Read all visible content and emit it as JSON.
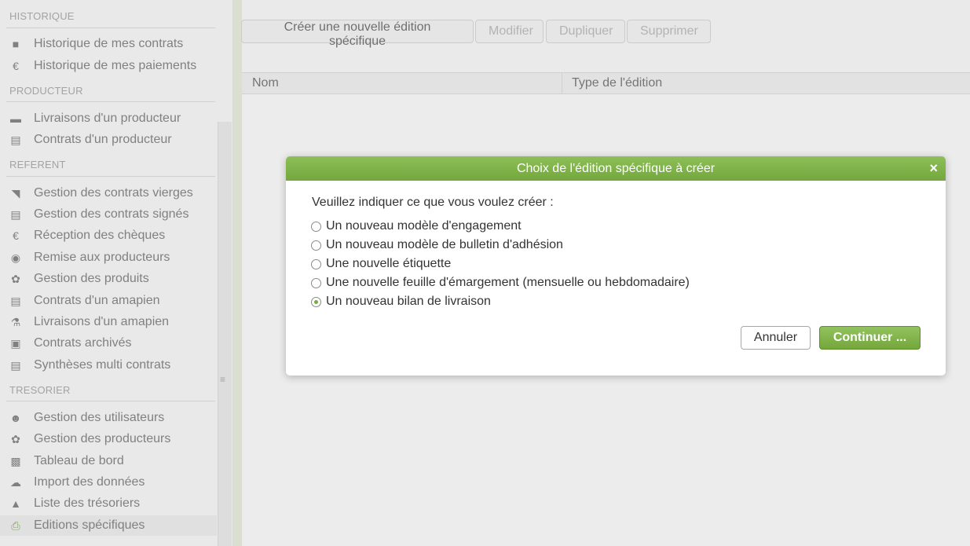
{
  "sidebar": {
    "sections": [
      {
        "title": "HISTORIQUE",
        "items": [
          {
            "label": "Historique de mes contrats",
            "icon": "book-icon"
          },
          {
            "label": "Historique de mes paiements",
            "icon": "euro-icon"
          }
        ]
      },
      {
        "title": "PRODUCTEUR",
        "items": [
          {
            "label": "Livraisons d'un producteur",
            "icon": "truck-icon"
          },
          {
            "label": "Contrats d'un producteur",
            "icon": "document-icon"
          }
        ]
      },
      {
        "title": "REFERENT",
        "items": [
          {
            "label": "Gestion des contrats vierges",
            "icon": "folder-open-icon"
          },
          {
            "label": "Gestion des contrats signés",
            "icon": "document-icon"
          },
          {
            "label": "Réception des chèques",
            "icon": "euro-icon"
          },
          {
            "label": "Remise aux producteurs",
            "icon": "money-icon"
          },
          {
            "label": "Gestion des produits",
            "icon": "leaf-icon"
          },
          {
            "label": "Contrats d'un amapien",
            "icon": "document-icon"
          },
          {
            "label": "Livraisons d'un amapien",
            "icon": "cutlery-icon"
          },
          {
            "label": "Contrats archivés",
            "icon": "archive-icon"
          },
          {
            "label": "Synthèses multi contrats",
            "icon": "document-icon"
          }
        ]
      },
      {
        "title": "TRESORIER",
        "items": [
          {
            "label": "Gestion des utilisateurs",
            "icon": "users-icon"
          },
          {
            "label": "Gestion des producteurs",
            "icon": "leaf-icon"
          },
          {
            "label": "Tableau de bord",
            "icon": "chart-icon"
          },
          {
            "label": "Import des données",
            "icon": "cloud-upload-icon"
          },
          {
            "label": "Liste des trésoriers",
            "icon": "graduation-cap-icon"
          },
          {
            "label": "Editions spécifiques",
            "icon": "printer-icon",
            "active": true
          }
        ]
      }
    ]
  },
  "toolbar": {
    "create_label": "Créer une nouvelle édition spécifique",
    "edit_label": "Modifier",
    "duplicate_label": "Dupliquer",
    "delete_label": "Supprimer"
  },
  "grid": {
    "columns": [
      "Nom",
      "Type de l'édition"
    ]
  },
  "dialog": {
    "title": "Choix de l'édition spécifique à créer",
    "close_glyph": "×",
    "prompt": "Veuillez indiquer ce que vous voulez créer :",
    "options": [
      {
        "label": "Un nouveau modèle d'engagement",
        "selected": false
      },
      {
        "label": "Un nouveau modèle de bulletin d'adhésion",
        "selected": false
      },
      {
        "label": "Une nouvelle étiquette",
        "selected": false
      },
      {
        "label": "Une nouvelle feuille d'émargement (mensuelle ou hebdomadaire)",
        "selected": false
      },
      {
        "label": "Un nouveau bilan de livraison",
        "selected": true
      }
    ],
    "cancel_label": "Annuler",
    "continue_label": "Continuer ..."
  },
  "colors": {
    "accent": "#7aab45",
    "header_green": "#80b34a"
  }
}
